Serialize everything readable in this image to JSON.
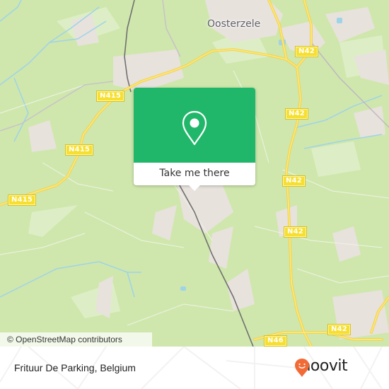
{
  "map": {
    "place_labels": [
      {
        "id": "oosterzele",
        "text": "Oosterzele"
      }
    ],
    "road_labels": [
      {
        "id": "n415-a",
        "text": "N415"
      },
      {
        "id": "n415-b",
        "text": "N415"
      },
      {
        "id": "n415-c",
        "text": "N415"
      },
      {
        "id": "n42-a",
        "text": "N42"
      },
      {
        "id": "n42-b",
        "text": "N42"
      },
      {
        "id": "n42-c",
        "text": "N42"
      },
      {
        "id": "n42-d",
        "text": "N42"
      },
      {
        "id": "n42-e",
        "text": "N42"
      },
      {
        "id": "n46",
        "text": "N46"
      }
    ],
    "attribution": "© OpenStreetMap contributors",
    "colors": {
      "land": "#cfe7ad",
      "water": "#9fd3e8",
      "road_major": "#f7dc4f",
      "built_up": "#e7e2dc",
      "popup_green": "#21b76a"
    }
  },
  "popup": {
    "icon": "map-pin-icon",
    "action_label": "Take me there"
  },
  "footer": {
    "place_name": "Frituur De Parking, Belgium",
    "brand": "moovit",
    "brand_color": "#f26a36"
  }
}
